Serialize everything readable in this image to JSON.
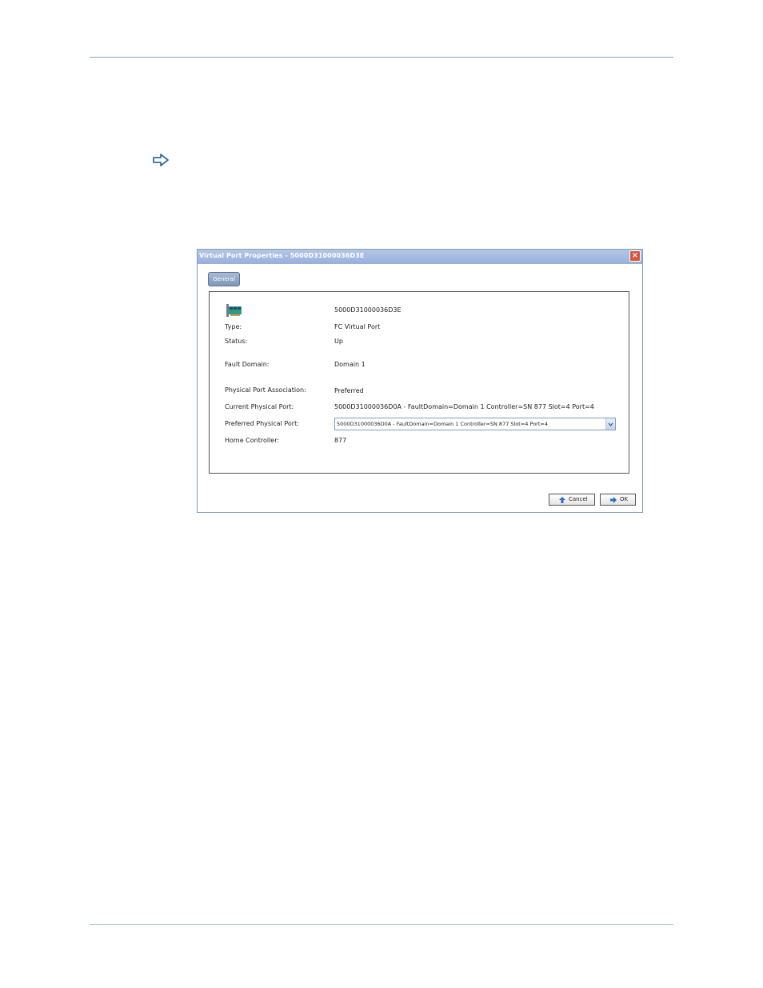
{
  "dialog": {
    "title": "Virtual Port Properties - 5000D31000036D3E",
    "close_glyph": "×",
    "tab_general": "General",
    "port_id": "5000D31000036D3E",
    "fields": {
      "type_label": "Type:",
      "type_value": "FC Virtual Port",
      "status_label": "Status:",
      "status_value": "Up",
      "fault_domain_label": "Fault Domain:",
      "fault_domain_value": "Domain 1",
      "association_label": "Physical Port Association:",
      "association_value": "Preferred",
      "current_port_label": "Current Physical Port:",
      "current_port_value": "5000D31000036D0A - FaultDomain=Domain 1 Controller=SN 877 Slot=4 Port=4",
      "preferred_port_label": "Preferred Physical Port:",
      "preferred_port_selected": "5000D31000036D0A - FaultDomain=Domain 1 Controller=SN 877 Slot=4 Port=4",
      "home_controller_label": "Home Controller:",
      "home_controller_value": "877"
    },
    "buttons": {
      "cancel_label": "Cancel",
      "ok_label": "OK"
    }
  },
  "icons": {
    "step": "right-arrow-icon",
    "port": "fc-port-icon",
    "cancel": "up-arrow-icon",
    "ok": "right-arrow-icon"
  },
  "colors": {
    "titlebar": "#a7bde3",
    "close": "#d8553c",
    "rule": "#7fa6bf",
    "tab": "#8ca3c6"
  }
}
